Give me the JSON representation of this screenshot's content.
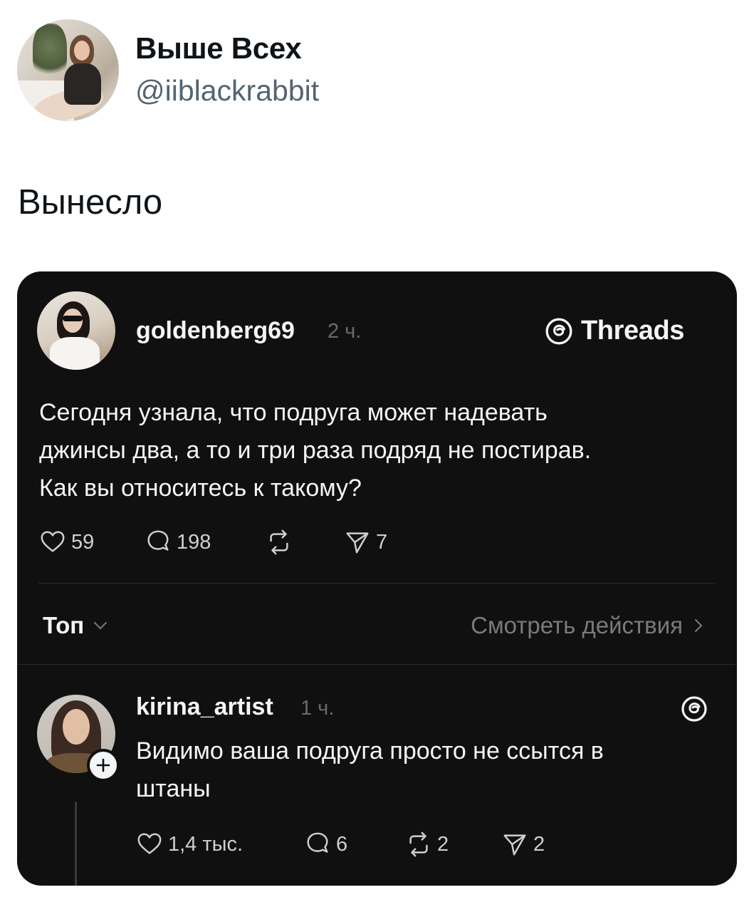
{
  "tweet": {
    "display_name": "Выше Всех",
    "handle": "@iiblackrabbit",
    "text": "Вынесло"
  },
  "threads_post": {
    "brand_label": "Threads",
    "brand_icon": "threads-logo-icon",
    "author": "goldenberg69",
    "time": "2 ч.",
    "body_lines": [
      "Сегодня узнала, что подруга может надевать",
      "джинсы два, а то и три раза подряд не постирав.",
      "Как вы относитесь к такому?"
    ],
    "actions": {
      "likes": "59",
      "comments": "198",
      "reposts": "",
      "shares": "7"
    },
    "sort_label": "Топ",
    "view_activity": "Смотреть действия",
    "reply": {
      "author": "kirina_artist",
      "time": "1 ч.",
      "body_lines": [
        "Видимо ваша подруга просто не ссытся в",
        "штаны"
      ],
      "actions": {
        "likes": "1,4 тыс.",
        "comments": "6",
        "reposts": "2",
        "shares": "2"
      }
    }
  },
  "colors": {
    "page_bg": "#ffffff",
    "card_bg": "#101010",
    "primary_text": "#0f1419",
    "secondary_text": "#536471",
    "card_text": "#f3f5f7",
    "card_muted": "#7a7a7a"
  }
}
